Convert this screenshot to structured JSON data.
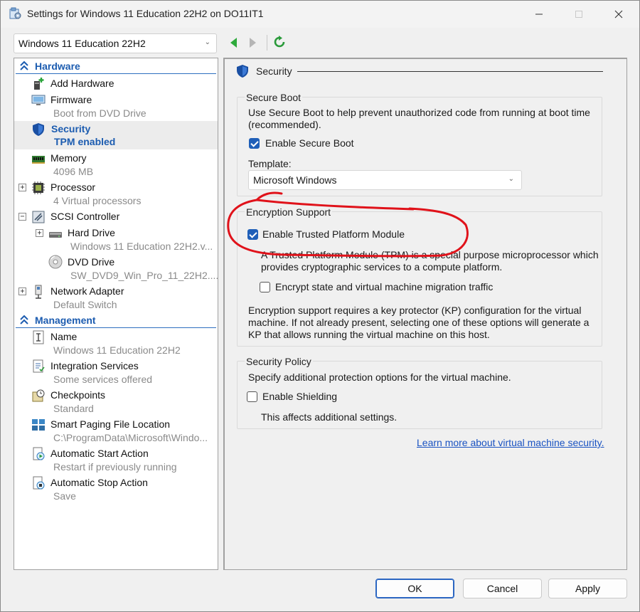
{
  "window": {
    "title": "Settings for Windows 11 Education 22H2 on DO11IT1",
    "minimize_icon": "minimize-icon",
    "maximize_icon": "maximize-icon",
    "close_icon": "close-icon"
  },
  "vm_selector": {
    "value": "Windows 11 Education 22H2"
  },
  "tree": {
    "hardware_header": "Hardware",
    "management_header": "Management",
    "items": [
      {
        "name": "Add Hardware",
        "sub": ""
      },
      {
        "name": "Firmware",
        "sub": "Boot from DVD Drive"
      },
      {
        "name": "Security",
        "sub": "TPM enabled"
      },
      {
        "name": "Memory",
        "sub": "4096 MB"
      },
      {
        "name": "Processor",
        "sub": "4 Virtual processors"
      },
      {
        "name": "SCSI Controller",
        "sub": ""
      },
      {
        "name": "Hard Drive",
        "sub": "Windows 11 Education 22H2.v..."
      },
      {
        "name": "DVD Drive",
        "sub": "SW_DVD9_Win_Pro_11_22H2...."
      },
      {
        "name": "Network Adapter",
        "sub": "Default Switch"
      },
      {
        "name": "Name",
        "sub": "Windows 11 Education 22H2"
      },
      {
        "name": "Integration Services",
        "sub": "Some services offered"
      },
      {
        "name": "Checkpoints",
        "sub": "Standard"
      },
      {
        "name": "Smart Paging File Location",
        "sub": "C:\\ProgramData\\Microsoft\\Windo..."
      },
      {
        "name": "Automatic Start Action",
        "sub": "Restart if previously running"
      },
      {
        "name": "Automatic Stop Action",
        "sub": "Save"
      }
    ]
  },
  "panel": {
    "title": "Security",
    "secure_boot": {
      "title": "Secure Boot",
      "desc_line1": "Use Secure Boot to help prevent unauthorized code from running at boot time",
      "desc_line2": "(recommended).",
      "enable_label": "Enable Secure Boot",
      "enable_checked": true,
      "template_label": "Template:",
      "template_value": "Microsoft Windows"
    },
    "encryption": {
      "title": "Encryption Support",
      "tpm_label": "Enable Trusted Platform Module",
      "tpm_checked": true,
      "tpm_desc_line1": "A Trusted Platform Module (TPM) is a special purpose microprocessor which",
      "tpm_desc_line2": "provides cryptographic services to a compute platform.",
      "encrypt_label": "Encrypt state and virtual machine migration traffic",
      "encrypt_checked": false,
      "kp_line1": "Encryption support requires a key protector (KP) configuration for the virtual",
      "kp_line2": "machine. If not already present, selecting one of these options will generate a",
      "kp_line3": "KP that allows running the virtual machine on this host."
    },
    "policy": {
      "title": "Security Policy",
      "desc": "Specify additional protection options for the virtual machine.",
      "shield_label": "Enable Shielding",
      "shield_checked": false,
      "shield_note": "This affects additional settings."
    },
    "learn_more": "Learn more about virtual machine security."
  },
  "buttons": {
    "ok": "OK",
    "cancel": "Cancel",
    "apply": "Apply"
  },
  "colors": {
    "accent": "#1f5fb8",
    "annotation": "#e0121a",
    "link": "#1a53c2"
  }
}
